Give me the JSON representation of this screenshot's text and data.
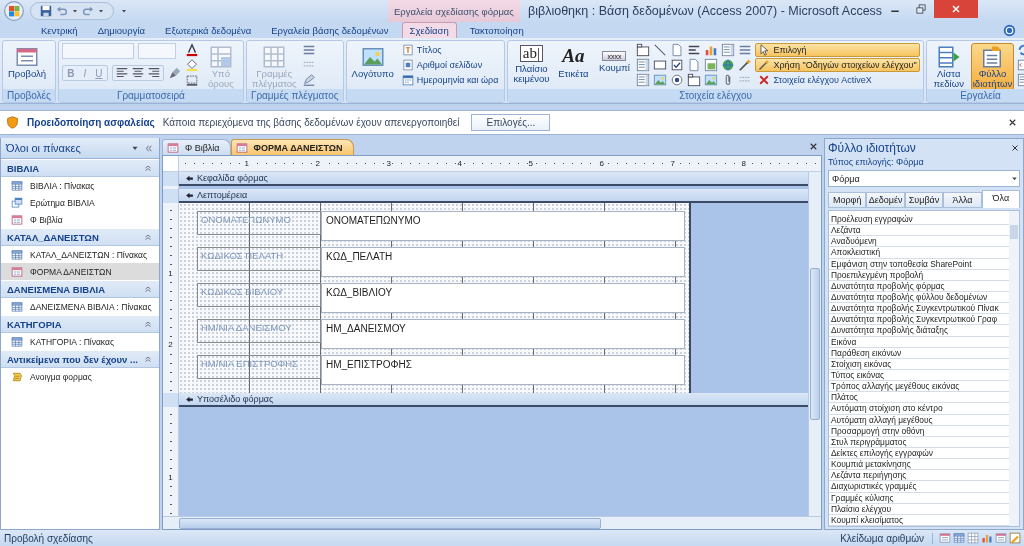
{
  "window": {
    "title": "βιβλιοθηκη : Βάση δεδομένων (Access 2007) - Microsoft Access",
    "context_label": "Εργαλεία σχεδίασης φόρμας"
  },
  "ribbon_tabs": [
    {
      "label": "Κεντρική",
      "selected": false
    },
    {
      "label": "Δημιουργία",
      "selected": false
    },
    {
      "label": "Εξωτερικά δεδομένα",
      "selected": false
    },
    {
      "label": "Εργαλεία βάσης δεδομένων",
      "selected": false
    },
    {
      "label": "Σχεδίαση",
      "selected": true
    },
    {
      "label": "Τακτοποίηση",
      "selected": false
    }
  ],
  "ribbon_groups": [
    {
      "label": "Προβολές",
      "items": [
        {
          "kind": "large",
          "label": "Προβολή",
          "disabled": false,
          "on": false
        }
      ]
    },
    {
      "label": "Γραμματοσειρά",
      "items": [
        {
          "kind": "font-controls",
          "buttons": [
            "B",
            "I",
            "U"
          ],
          "disabled": true
        },
        {
          "kind": "large",
          "label": "Υπό όρους",
          "disabled": true,
          "on": false
        }
      ]
    },
    {
      "label": "Γραμμές πλέγματος",
      "items": [
        {
          "kind": "large",
          "label": "Γραμμές πλέγματος",
          "disabled": true,
          "on": false
        },
        {
          "kind": "icon-column"
        }
      ]
    },
    {
      "items": [
        {
          "kind": "large",
          "label": "Λογότυπο",
          "disabled": false,
          "on": false
        },
        {
          "kind": "small-stack",
          "items": [
            {
              "label": "Τίτλος",
              "on": false
            },
            {
              "label": "Αριθμοί σελίδων",
              "on": false
            },
            {
              "label": "Ημερομηνία και ώρα",
              "on": false
            }
          ]
        }
      ]
    },
    {
      "label": "Στοιχεία ελέγχου",
      "items": [
        {
          "kind": "large",
          "glyph": "ab|",
          "label": "Πλαίσιο κειμένου",
          "disabled": false,
          "on": false
        },
        {
          "kind": "large",
          "glyph": "Aa",
          "label": "Ετικέτα",
          "disabled": false,
          "on": false
        },
        {
          "kind": "large",
          "glyph": "xxxx",
          "label": "Κουμπί",
          "disabled": false,
          "on": false
        },
        {
          "kind": "icon-grid"
        },
        {
          "kind": "icon-column"
        },
        {
          "kind": "small-stack",
          "items": [
            {
              "label": "Επιλογή",
              "on": true
            },
            {
              "label": "Χρήση \"Οδηγών στοιχείων ελέγχου\"",
              "on": true
            },
            {
              "label": "Στοιχεία ελέγχου ActiveX",
              "on": false
            }
          ]
        }
      ]
    },
    {
      "label": "Εργαλεία",
      "items": [
        {
          "kind": "large",
          "label": "Λίστα πεδίων",
          "disabled": false,
          "on": false
        },
        {
          "kind": "large",
          "label": "Φύλλο ιδιοτήτων",
          "disabled": false,
          "on": true
        },
        {
          "kind": "icon-column"
        }
      ]
    }
  ],
  "security_bar": {
    "title": "Προειδοποίηση ασφαλείας",
    "message": "Κάποια περιεχόμενα της βάσης δεδομένων έχουν απενεργοποιηθεί",
    "button": "Επιλογές..."
  },
  "navigation_pane": {
    "title": "Όλοι οι πίνακες",
    "groups": [
      {
        "title": "ΒΙΒΛΙΑ",
        "items": [
          {
            "label": "ΒΙΒΛΙΑ : Πίνακας",
            "kind": "table",
            "selected": false
          },
          {
            "label": "Ερώτημα ΒΙΒΛΙΑ",
            "kind": "query",
            "selected": false
          },
          {
            "label": "Φ Βιβλία",
            "kind": "form",
            "selected": false
          }
        ]
      },
      {
        "title": "ΚΑΤΑΛ_ΔΑΝΕΙΣΤΩΝ",
        "items": [
          {
            "label": "ΚΑΤΑΛ_ΔΑΝΕΙΣΤΩΝ : Πίνακας",
            "kind": "table",
            "selected": false
          },
          {
            "label": "ΦΟΡΜΑ ΔΑΝΕΙΣΤΩΝ",
            "kind": "form",
            "selected": true
          }
        ]
      },
      {
        "title": "ΔΑΝΕΙΣΜΕΝΑ ΒΙΒΛΙΑ",
        "items": [
          {
            "label": "ΔΑΝΕΙΣΜΕΝΑ ΒΙΒΛΙΑ : Πίνακας",
            "kind": "table",
            "selected": false
          }
        ]
      },
      {
        "title": "ΚΑΤΗΓΟΡΙΑ",
        "items": [
          {
            "label": "ΚΑΤΗΓΟΡΙΑ : Πίνακας",
            "kind": "table",
            "selected": false
          }
        ]
      },
      {
        "title": "Αντικείμενα που δεν έχουν ...",
        "items": [
          {
            "label": "Ανοιγμα φορμας",
            "kind": "macro",
            "selected": false
          }
        ]
      }
    ]
  },
  "document_tabs": [
    {
      "label": "Φ Βιβλία",
      "selected": false
    },
    {
      "label": "ΦΟΡΜΑ ΔΑΝΕΙΣΤΩΝ",
      "selected": true
    }
  ],
  "form_design": {
    "ruler": [
      "1",
      "2",
      "3",
      "4",
      "5",
      "6",
      "7",
      "8"
    ],
    "vertical_ruler": [
      "1",
      "2"
    ],
    "footer_ruler": [
      "1"
    ],
    "header_section": "Κεφαλίδα φόρμας",
    "detail_section": "Λεπτομέρεια",
    "footer_section": "Υποσέλιδο φόρμας",
    "fields": [
      {
        "label": "ΟΝΟΜΑΤΕΠΩΝΥΜΟ",
        "control": "ΟΝΟΜΑΤΕΠΩΝΥΜΟ"
      },
      {
        "label": "ΚΩΔΙΚΟΣ ΠΕΛΑΤΗ",
        "control": "ΚΩΔ_ΠΕΛΑΤΗ"
      },
      {
        "label": "ΚΩΔΙΚΟΣ ΒΙΒΛΙΟΥ",
        "control": "ΚΩΔ_ΒΙΒΛΙΟΥ"
      },
      {
        "label": "ΗΜ/ΝΙΑ ΔΑΝΕΙΣΜΟΥ",
        "control": "ΗΜ_ΔΑΝΕΙΣΜΟΥ"
      },
      {
        "label": "ΗΜ/ΝΙΑ ΕΠΙΣΤΡΟΦΗΣ",
        "control": "ΗΜ_ΕΠΙΣΤΡΟΦΗΣ"
      }
    ]
  },
  "property_sheet": {
    "title": "Φύλλο ιδιοτήτων",
    "selection_type": "Τύπος επιλογής: Φόρμα",
    "object": "Φόρμα",
    "tabs": [
      {
        "label": "Μορφή",
        "selected": false
      },
      {
        "label": "Δεδομέν",
        "selected": false
      },
      {
        "label": "Συμβάν",
        "selected": false
      },
      {
        "label": "Άλλα",
        "selected": false
      },
      {
        "label": "Όλα",
        "selected": true
      }
    ],
    "properties": [
      "Προέλευση εγγραφών",
      "Λεζάντα",
      "Αναδυόμενη",
      "Αποκλειστική",
      "Εμφάνιση στην τοποθεσία SharePoint",
      "Προεπιλεγμένη προβολή",
      "Δυνατότητα προβολής φόρμας",
      "Δυνατότητα προβολής φύλλου δεδομένων",
      "Δυνατότητα προβολής Συγκεντρωτικού Πίνακ",
      "Δυνατότητα προβολής Συγκεντρωτικού Γραφ",
      "Δυνατότητα προβολής διάταξης",
      "Εικόνα",
      "Παράθεση εικόνων",
      "Στοίχιση εικόνας",
      "Τύπος εικόνας",
      "Τρόπος αλλαγής μεγέθους εικόνας",
      "Πλάτος",
      "Αυτόματη στοίχιση στο κέντρο",
      "Αυτόματη αλλαγή μεγέθους",
      "Προσαρμογή στην οθόνη",
      "Στυλ περιγράμματος",
      "Δείκτες επιλογής εγγραφών",
      "Κουμπιά μετακίνησης",
      "Λεζάντα περιήγησης",
      "Διαχωριστικές γραμμές",
      "Γραμμές κύλισης",
      "Πλαίσιο ελέγχου",
      "Κουμπί κλεισίματος"
    ]
  },
  "status_bar": {
    "left": "Προβολή σχεδίασης",
    "right": "Κλείδωμα αριθμών"
  }
}
